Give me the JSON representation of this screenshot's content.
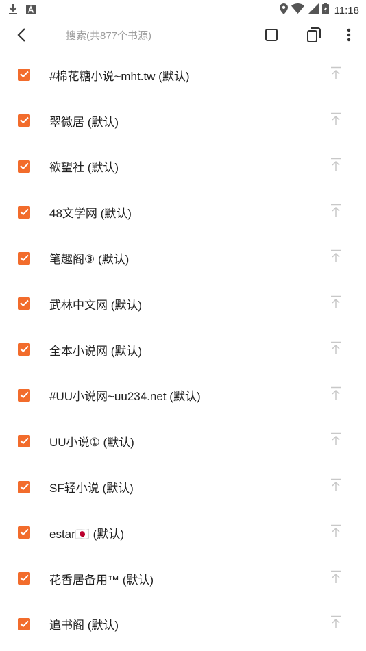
{
  "status_bar": {
    "left_icons": [
      "download-icon",
      "a-notification-icon"
    ],
    "right_icons": [
      "location-icon",
      "wifi-icon",
      "signal-icon",
      "battery-icon"
    ],
    "time": "11:18"
  },
  "toolbar": {
    "back_icon": "arrow-left-icon",
    "search_placeholder": "搜索(共877个书源)",
    "search_value": "",
    "actions": [
      "select-all-icon",
      "invert-selection-icon",
      "more-vert-icon"
    ]
  },
  "colors": {
    "accent": "#f26c2c",
    "top_icon": "#c8c8c8",
    "placeholder": "#9e9e9e"
  },
  "sources": [
    {
      "label": "#棉花糖小说~mht.tw (默认)",
      "checked": true
    },
    {
      "label": "翠微居 (默认)",
      "checked": true
    },
    {
      "label": "欲望社 (默认)",
      "checked": true
    },
    {
      "label": "48文学网 (默认)",
      "checked": true
    },
    {
      "label": "笔趣阁③ (默认)",
      "checked": true
    },
    {
      "label": "武林中文网 (默认)",
      "checked": true
    },
    {
      "label": "全本小说网 (默认)",
      "checked": true
    },
    {
      "label": "#UU小说网~uu234.net (默认)",
      "checked": true
    },
    {
      "label": "UU小说① (默认)",
      "checked": true
    },
    {
      "label": "SF轻小说 (默认)",
      "checked": true
    },
    {
      "label": "estar🇯🇵 (默认)",
      "checked": true
    },
    {
      "label": "花香居备用™ (默认)",
      "checked": true
    },
    {
      "label": "追书阁 (默认)",
      "checked": true
    }
  ],
  "row_action_icon": "move-to-top-icon"
}
